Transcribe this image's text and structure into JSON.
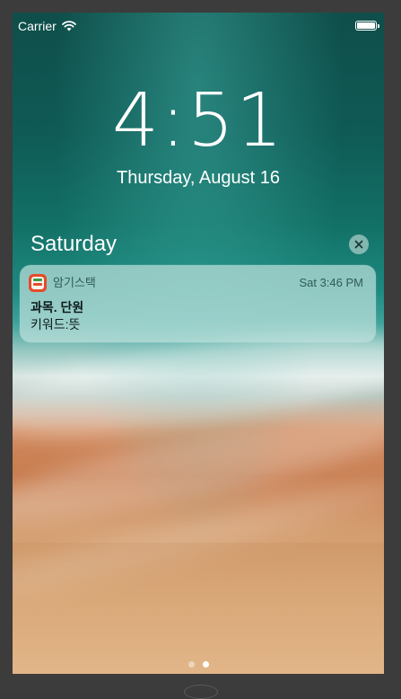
{
  "status_bar": {
    "carrier": "Carrier",
    "wifi_icon": "wifi-icon",
    "battery_icon": "battery-icon"
  },
  "lock_screen": {
    "time": "4:51",
    "date": "Thursday, August 16"
  },
  "notification_group": {
    "header": "Saturday",
    "clear_icon": "close-icon"
  },
  "notification": {
    "app_icon": "app-icon",
    "app_name": "암기스택",
    "time": "Sat 3:46 PM",
    "title": "과목. 단원",
    "body": "키워드:뜻"
  },
  "page_indicator": {
    "total": 2,
    "active_index": 1
  }
}
